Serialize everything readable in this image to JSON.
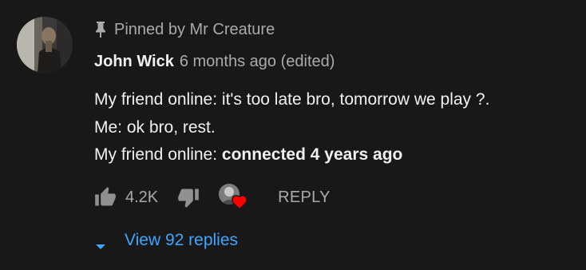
{
  "comment": {
    "pinned_label": "Pinned by Mr Creature",
    "author": "John Wick",
    "timestamp": "6 months ago (edited)",
    "body_lines": [
      "My friend online: it's too late bro, tomorrow we play ?.",
      "Me: ok bro, rest.",
      "My friend online: "
    ],
    "body_bold_tail": "connected 4 years ago",
    "like_count": "4.2K",
    "reply_label": "REPLY",
    "view_replies_label": "View 92 replies",
    "hearted_by_creator": true
  },
  "icons": {
    "pin": "pin-icon",
    "like": "thumbs-up-icon",
    "dislike": "thumbs-down-icon",
    "heart": "heart-icon",
    "expand": "caret-down-icon"
  },
  "colors": {
    "background": "#181818",
    "primary_text": "#f1f1f1",
    "secondary_text": "#aaaaaa",
    "link_blue": "#3ea6ff",
    "heart_red": "#ff0000"
  }
}
